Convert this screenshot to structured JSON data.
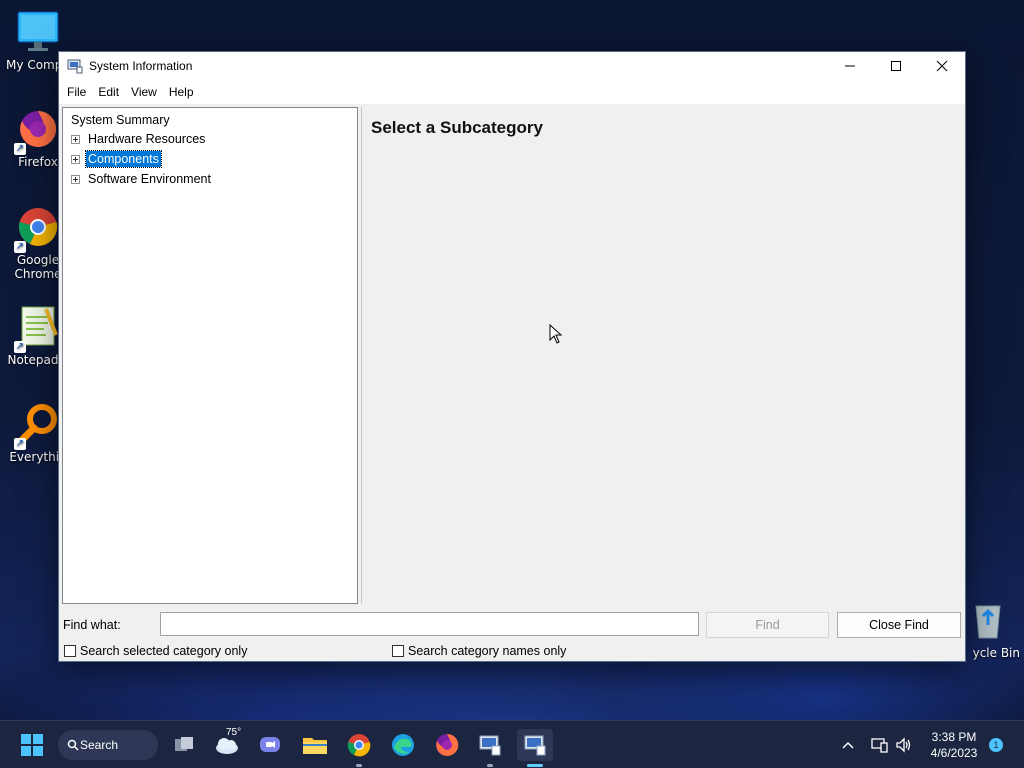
{
  "desktop": {
    "icons": [
      {
        "label": "My Compu",
        "icon": "monitor-icon"
      },
      {
        "label": "Firefox",
        "icon": "firefox-icon"
      },
      {
        "label": "Google Chrome",
        "icon": "chrome-icon"
      },
      {
        "label": "Notepad+",
        "icon": "notepad-plus-icon"
      },
      {
        "label": "Everythin",
        "icon": "everything-search-icon"
      },
      {
        "label": "ycle Bin",
        "icon": "recycle-bin-icon"
      }
    ]
  },
  "window": {
    "title": "System Information",
    "controls": {
      "minimize": "—",
      "maximize": "☐",
      "close": "✕"
    },
    "menu": [
      "File",
      "Edit",
      "View",
      "Help"
    ],
    "tree": {
      "root": "System Summary",
      "children": [
        {
          "label": "Hardware Resources",
          "selected": false
        },
        {
          "label": "Components",
          "selected": true
        },
        {
          "label": "Software Environment",
          "selected": false
        }
      ]
    },
    "detail_title": "Select a Subcategory",
    "find": {
      "label": "Find what:",
      "value": "",
      "find_button": "Find",
      "close_find_button": "Close Find",
      "search_selected_only": "Search selected category only",
      "search_names_only": "Search category names only"
    }
  },
  "taskbar": {
    "search_label": "Search",
    "weather_temp": "75°",
    "time": "3:38 PM",
    "date": "4/6/2023",
    "notification_count": "1"
  },
  "colors": {
    "selection": "#0078d7",
    "taskbar": "#1c2640",
    "window_bg": "#f0f0f0"
  }
}
